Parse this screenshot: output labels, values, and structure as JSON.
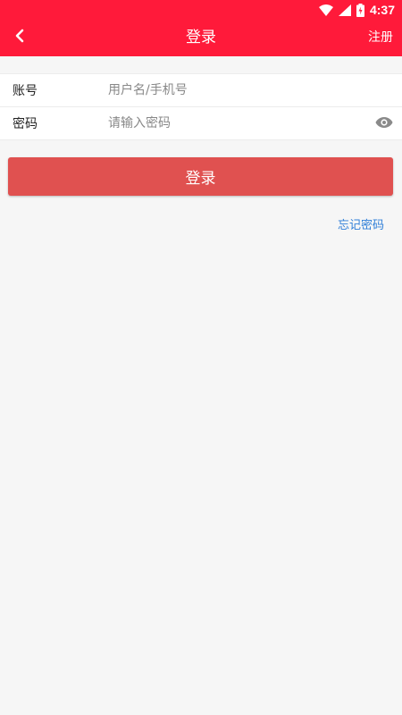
{
  "status_bar": {
    "time": "4:37",
    "icons": [
      "wifi-icon",
      "cell-signal-icon",
      "battery-charging-icon"
    ]
  },
  "app_bar": {
    "back_icon": "chevron-left-icon",
    "title": "登录",
    "register_label": "注册"
  },
  "form": {
    "account": {
      "label": "账号",
      "placeholder": "用户名/手机号",
      "value": ""
    },
    "password": {
      "label": "密码",
      "placeholder": "请输入密码",
      "value": "",
      "toggle_icon": "eye-icon"
    }
  },
  "login_button_label": "登录",
  "forgot_password_label": "忘记密码",
  "colors": {
    "header": "#ff1a3a",
    "login_button": "#e05150",
    "link": "#2f7fd8",
    "background": "#f6f6f6"
  }
}
